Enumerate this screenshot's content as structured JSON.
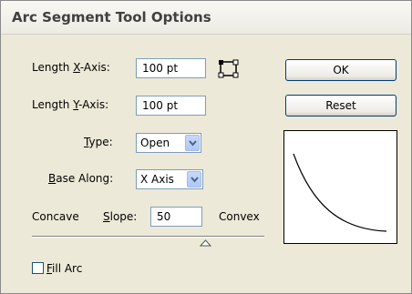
{
  "window": {
    "title": "Arc Segment Tool Options"
  },
  "fields": {
    "length_x": {
      "label_pre": "Length ",
      "label_key": "X",
      "label_post": "-Axis:",
      "value": "100 pt"
    },
    "length_y": {
      "label_pre": "Length ",
      "label_key": "Y",
      "label_post": "-Axis:",
      "value": "100 pt"
    },
    "type": {
      "label_key": "T",
      "label_post": "ype:",
      "value": "Open"
    },
    "base_along": {
      "label_key": "B",
      "label_post": "ase Along:",
      "value": "X Axis"
    },
    "slope": {
      "concave_label": "Concave",
      "label_key": "S",
      "label_post": "lope:",
      "value": "50",
      "convex_label": "Convex",
      "level": 50
    },
    "fill_arc": {
      "label_key": "F",
      "label_post": "ill Arc",
      "checked": false
    }
  },
  "buttons": {
    "ok": "OK",
    "reset": "Reset"
  },
  "icons": {
    "aspect": "reference-point-icon",
    "dropdown": "chevron-down-icon"
  }
}
